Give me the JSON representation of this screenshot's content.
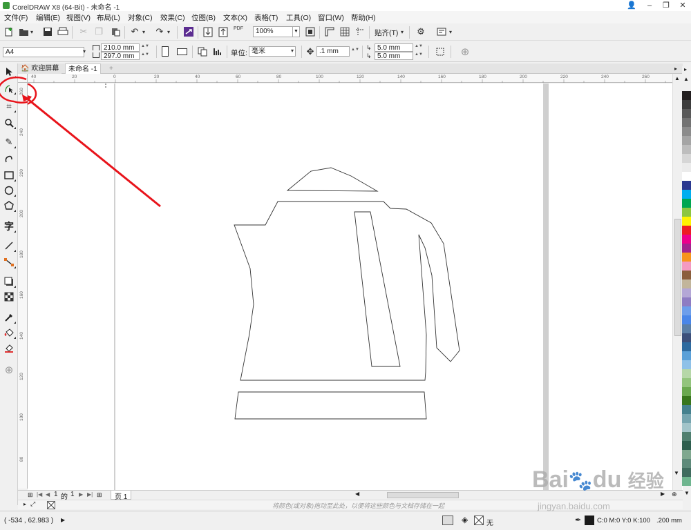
{
  "window": {
    "title": "CorelDRAW X8 (64-Bit) - 未命名 -1",
    "controls": [
      "👤",
      "–",
      "❐",
      "✕"
    ]
  },
  "menu": [
    "文件(F)",
    "编辑(E)",
    "视图(V)",
    "布局(L)",
    "对象(C)",
    "效果(C)",
    "位图(B)",
    "文本(X)",
    "表格(T)",
    "工具(O)",
    "窗口(W)",
    "帮助(H)"
  ],
  "toolbar": {
    "zoom": "100%",
    "snap_label": "贴齐(T)",
    "pdf_label": "PDF"
  },
  "property_bar": {
    "page_size": "A4",
    "width": "210.0 mm",
    "height": "297.0 mm",
    "unit_label": "单位:",
    "unit": "毫米",
    "nudge": ".1 mm",
    "dup_x": "5.0 mm",
    "dup_y": "5.0 mm"
  },
  "tabs": {
    "welcome": "欢迎屏幕",
    "document": "未命名 -1"
  },
  "rulers": {
    "h_ticks": [
      "40",
      "20",
      "0",
      "20",
      "40",
      "60",
      "80",
      "100",
      "120",
      "140",
      "160",
      "180",
      "200",
      "220",
      "240",
      "260"
    ],
    "v_ticks": [
      "260",
      "240",
      "220",
      "200",
      "180",
      "160",
      "140",
      "120",
      "100",
      "80"
    ]
  },
  "page_nav": {
    "current": "1",
    "of_label": "的",
    "total": "1",
    "page_tab": "页 1"
  },
  "hint": "将颜色(或对象)拖动至此处，以便将这些颜色与文档存储在一起",
  "status": {
    "coords": "( -534 , 62.983 )",
    "fill_none": "无",
    "outline_color": "C:0 M:0 Y:0 K:100",
    "outline_width": ".200 mm"
  },
  "watermark": {
    "brand": "Bai",
    "brand2": "du",
    "brand_cn": "经验",
    "url": "jingyan.baidu.com"
  },
  "colors": {
    "annotation": "#e8141b",
    "page_border": "#a0a0a0",
    "palette": [
      "#231f20",
      "#3d3d3d",
      "#5a5a5a",
      "#737373",
      "#8c8c8c",
      "#a5a5a5",
      "#bdbdbd",
      "#d6d6d6",
      "#ebebeb",
      "#ffffff",
      "#2b3990",
      "#00aeef",
      "#00a651",
      "#8dc63f",
      "#fff200",
      "#ed1c24",
      "#ec008c",
      "#a3238e",
      "#f7941d",
      "#f49ac1",
      "#8b5e3c",
      "#c2b59b",
      "#b4a7d6",
      "#8e7cc3",
      "#6d9eeb",
      "#4a86e8",
      "#5b7fa6",
      "#3c4f7a",
      "#2d6a9f",
      "#5aa0d8",
      "#8fc1e8",
      "#b6d7a8",
      "#93c47d",
      "#6aa84f",
      "#38761d",
      "#45818e",
      "#76a5af",
      "#a2c4c9",
      "#4f7f6f",
      "#2e5e4e",
      "#7fa88f",
      "#5e8a7a",
      "#3f6b5e",
      "#6fb58f"
    ]
  }
}
